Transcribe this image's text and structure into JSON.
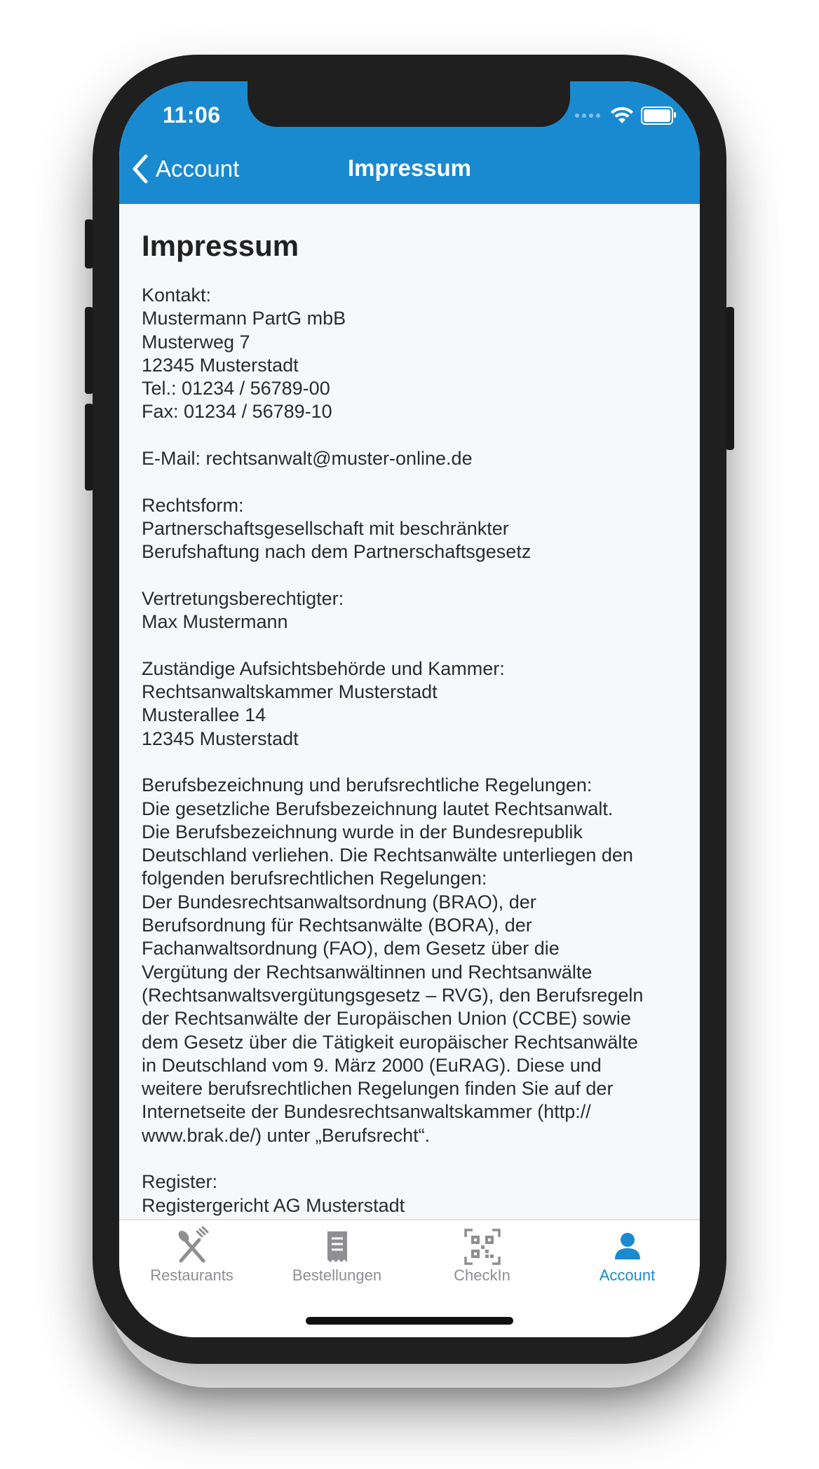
{
  "status_bar": {
    "time": "11:06"
  },
  "nav": {
    "back_label": "Account",
    "title": "Impressum"
  },
  "content": {
    "heading": "Impressum",
    "paragraphs": [
      "Kontakt:\nMustermann PartG mbB\nMusterweg 7\n12345 Musterstadt\nTel.: 01234 / 56789-00\nFax: 01234 / 56789-10",
      "E-Mail: rechtsanwalt@muster-online.de",
      "Rechtsform:\nPartnerschaftsgesellschaft mit beschränkter\nBerufshaftung nach dem Partnerschaftsgesetz",
      "Vertretungsberechtigter:\nMax Mustermann",
      "Zuständige Aufsichtsbehörde und Kammer:\nRechtsanwaltskammer Musterstadt\nMusterallee 14\n12345 Musterstadt",
      "Berufsbezeichnung und berufsrechtliche Regelungen:\nDie gesetzliche Berufsbezeichnung lautet Rechtsanwalt.\nDie Berufsbezeichnung wurde in der Bundesrepublik\nDeutschland verliehen. Die Rechtsanwälte unterliegen den\nfolgenden berufsrechtlichen Regelungen:\nDer Bundesrechtsanwaltsordnung (BRAO), der\nBerufsordnung für Rechtsanwälte (BORA), der\nFachanwaltsordnung (FAO), dem Gesetz über die\nVergütung der Rechtsanwältinnen und Rechtsanwälte\n(Rechtsanwaltsvergütungsgesetz – RVG), den Berufsregeln\nder Rechtsanwälte der Europäischen Union (CCBE) sowie\ndem Gesetz über die Tätigkeit europäischer Rechtsanwälte\nin Deutschland vom 9. März 2000 (EuRAG). Diese und\nweitere berufsrechtlichen Regelungen finden Sie auf der\nInternetseite der Bundesrechtsanwaltskammer (http://\nwww.brak.de/) unter „Berufsrecht“.",
      "Register:\nRegistergericht AG Musterstadt"
    ]
  },
  "tabbar": {
    "tabs": [
      {
        "label": "Restaurants",
        "icon": "fork-knife-icon"
      },
      {
        "label": "Bestellungen",
        "icon": "receipt-icon"
      },
      {
        "label": "CheckIn",
        "icon": "qr-code-icon"
      },
      {
        "label": "Account",
        "icon": "person-icon"
      }
    ],
    "active": "Account"
  },
  "colors": {
    "primary": "#1a8ad0",
    "background": "#f7f8fa",
    "inactive_tab": "#8e8e93"
  }
}
